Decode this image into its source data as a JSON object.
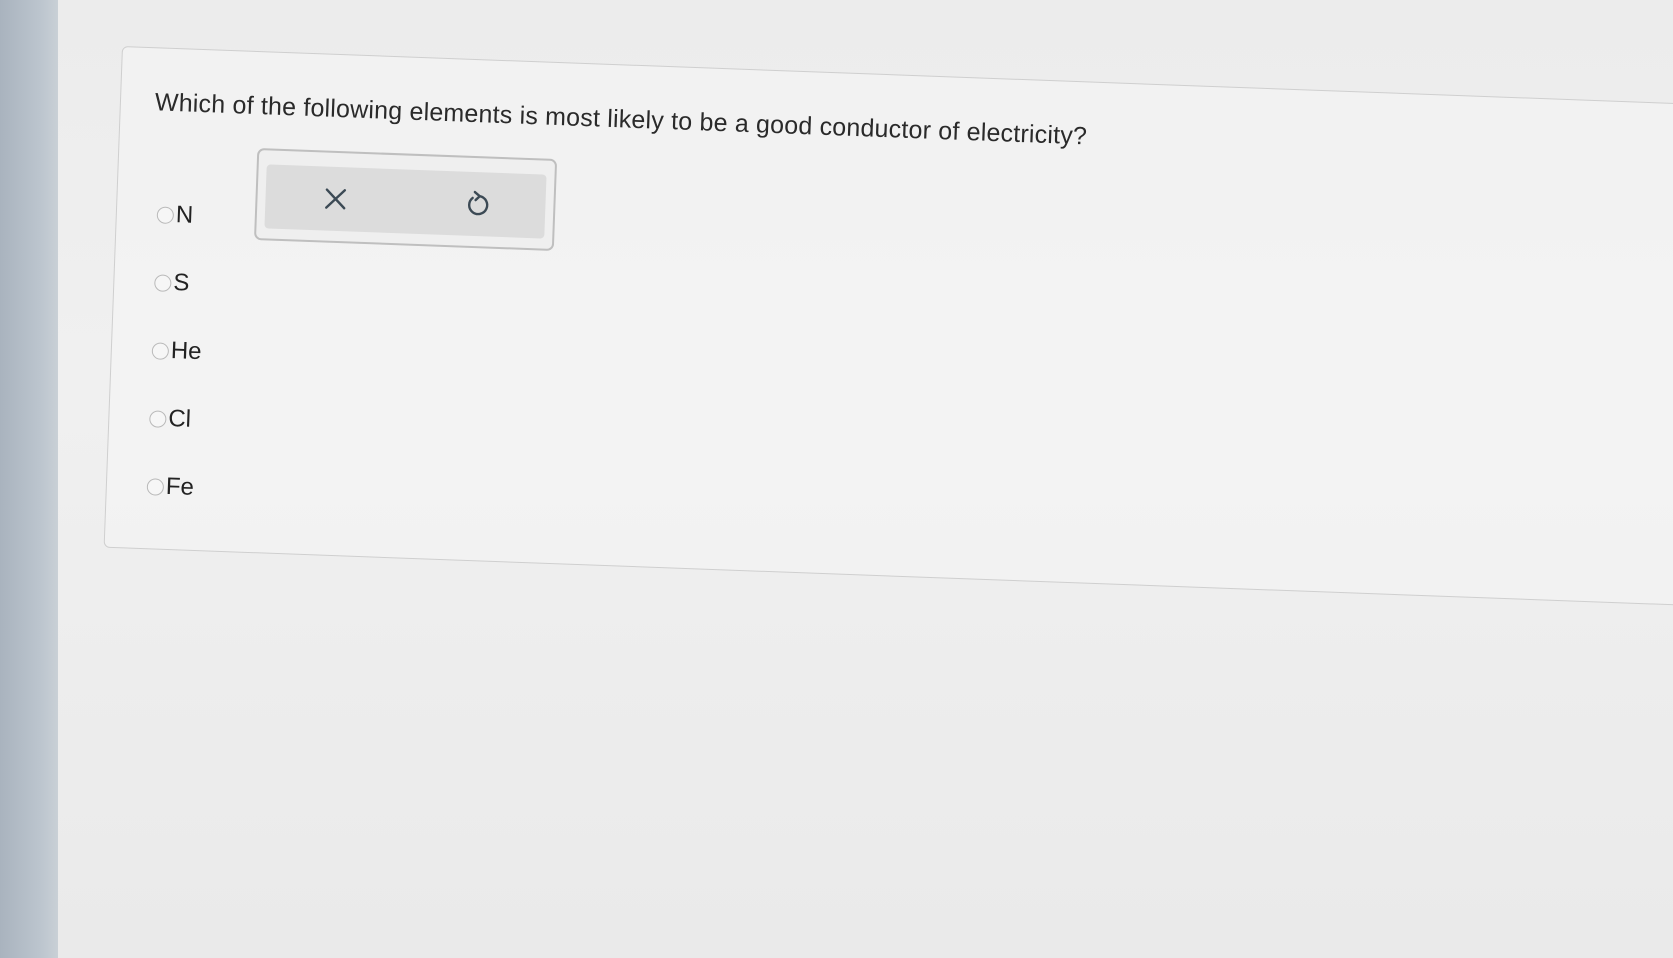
{
  "question": {
    "text": "Which of the following elements is most likely to be a good conductor of electricity?"
  },
  "options": [
    {
      "label": "N"
    },
    {
      "label": "S"
    },
    {
      "label": "He"
    },
    {
      "label": "Cl"
    },
    {
      "label": "Fe"
    }
  ],
  "toolbox": {
    "clear_icon": "close-icon",
    "undo_icon": "undo-icon"
  },
  "colors": {
    "text": "#222222",
    "card_border": "#cfcfcf",
    "toolbox_bg": "#dcdcdc",
    "icon": "#3c4a55"
  }
}
